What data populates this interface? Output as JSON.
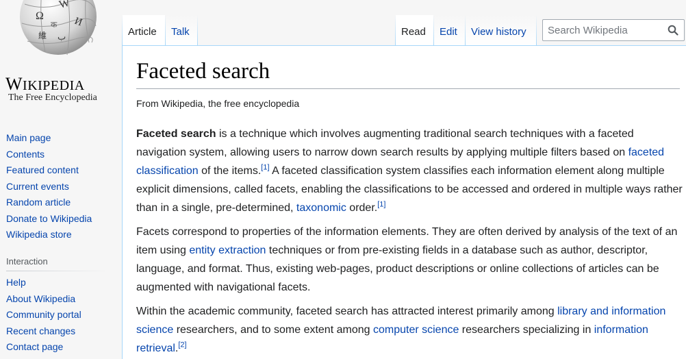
{
  "logo": {
    "wordmark_big_w": "W",
    "wordmark_rest": "IKIPEDIA",
    "tagline": "The Free Encyclopedia",
    "glyphs": [
      "Ω",
      "W",
      "И",
      "維",
      "ب",
      "क"
    ]
  },
  "nav_main": [
    "Main page",
    "Contents",
    "Featured content",
    "Current events",
    "Random article",
    "Donate to Wikipedia",
    "Wikipedia store"
  ],
  "nav_interaction_heading": "Interaction",
  "nav_interaction": [
    "Help",
    "About Wikipedia",
    "Community portal",
    "Recent changes",
    "Contact page"
  ],
  "tabs": {
    "article": "Article",
    "talk": "Talk",
    "read": "Read",
    "edit": "Edit",
    "history": "View history"
  },
  "search": {
    "placeholder": "Search Wikipedia"
  },
  "article": {
    "title": "Faceted search",
    "site_sub": "From Wikipedia, the free encyclopedia",
    "p1": {
      "bold": "Faceted search",
      "t1": " is a technique which involves augmenting traditional search techniques with a faceted navigation system, allowing users to narrow down search results by applying multiple filters based on ",
      "link1": "faceted classification",
      "t2": " of the items.",
      "ref1": "[1]",
      "t3": " A faceted classification system classifies each information element along multiple explicit dimensions, called facets, enabling the classifications to be accessed and ordered in multiple ways rather than in a single, pre-determined, ",
      "link2": "taxonomic",
      "t4": " order.",
      "ref2": "[1]"
    },
    "p2": {
      "t1": "Facets correspond to properties of the information elements. They are often derived by analysis of the text of an item using ",
      "link1": "entity extraction",
      "t2": " techniques or from pre-existing fields in a database such as author, descriptor, language, and format. Thus, existing web-pages, product descriptions or online collections of articles can be augmented with navigational facets."
    },
    "p3": {
      "t1": "Within the academic community, faceted search has attracted interest primarily among ",
      "link1": "library and information science",
      "t2": " researchers, and to some extent among ",
      "link2": "computer science",
      "t3": " researchers specializing in ",
      "link3": "information retrieval",
      "t4": ".",
      "ref1": "[2]"
    }
  },
  "colors": {
    "link": "#0645ad",
    "text": "#202122",
    "tab_border": "#a7d7f9",
    "sidebar_bg": "#f6f6f6"
  }
}
